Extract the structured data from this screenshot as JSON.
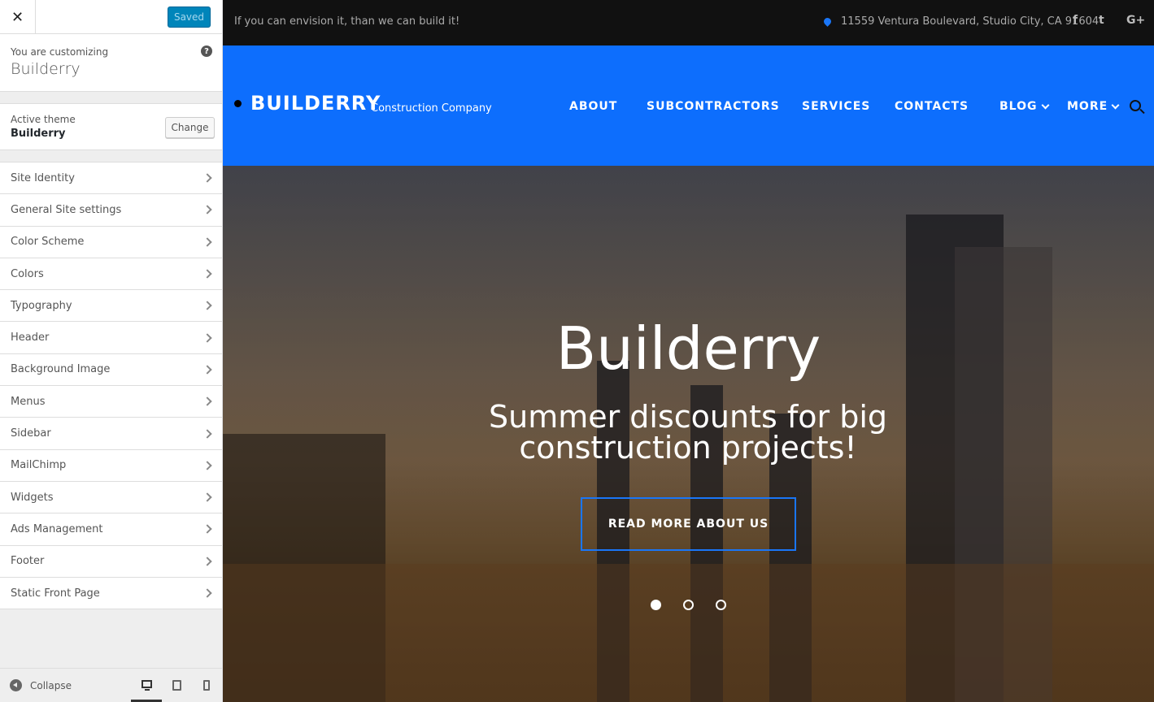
{
  "sidebar": {
    "saved_label": "Saved",
    "customizing_label": "You are customizing",
    "site_name": "Builderry",
    "active_theme_label": "Active theme",
    "theme_name": "Builderry",
    "change_label": "Change",
    "sections": [
      {
        "label": "Site Identity"
      },
      {
        "label": "General Site settings"
      },
      {
        "label": "Color Scheme"
      },
      {
        "label": "Colors"
      },
      {
        "label": "Typography"
      },
      {
        "label": "Header"
      },
      {
        "label": "Background Image"
      },
      {
        "label": "Menus"
      },
      {
        "label": "Sidebar"
      },
      {
        "label": "MailChimp"
      },
      {
        "label": "Widgets"
      },
      {
        "label": "Ads Management"
      },
      {
        "label": "Footer"
      },
      {
        "label": "Static Front Page"
      }
    ],
    "collapse_label": "Collapse"
  },
  "site": {
    "tagline": "If you can envision it, than we can build it!",
    "address": "11559 Ventura Boulevard, Studio City, CA 91604",
    "social": {
      "facebook": "f",
      "twitter": "t",
      "google": "G+"
    },
    "logo": "BUILDERRY",
    "logo_sub": "Construction Company",
    "nav": {
      "about": "ABOUT",
      "subcontractors": "SUBCONTRACTORS",
      "services": "SERVICES",
      "contacts": "CONTACTS",
      "blog": "BLOG",
      "more": "MORE"
    },
    "hero": {
      "title": "Builderry",
      "subtitle": "Summer discounts for big construction projects!",
      "button": "READ MORE ABOUT US"
    }
  },
  "colors": {
    "accent": "#0d6efd",
    "saved_button": "#0085ba",
    "topbar": "#111111"
  }
}
